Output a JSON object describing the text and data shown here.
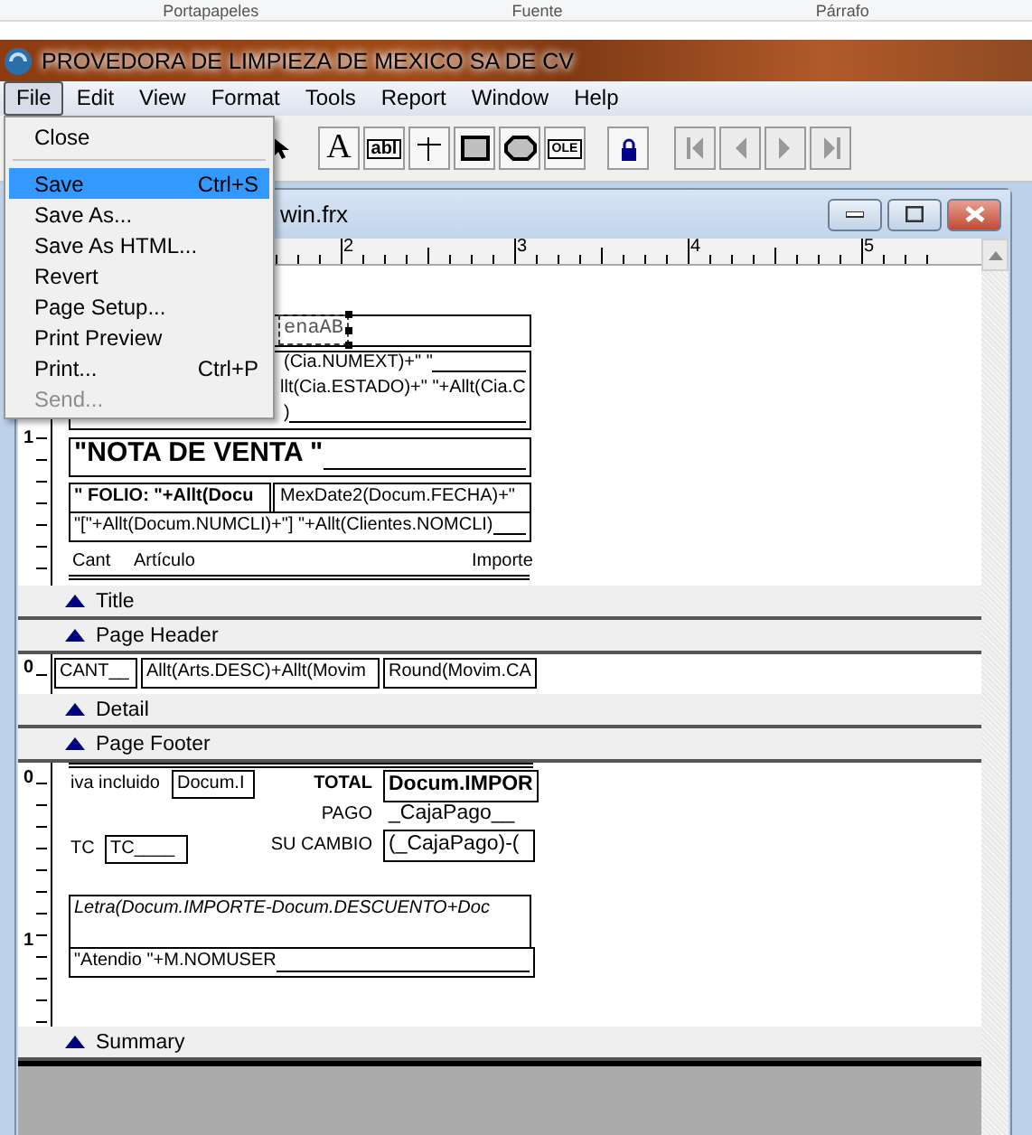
{
  "ribbon_fragment": [
    "Portapapeles",
    "Fuente",
    "Párrafo"
  ],
  "window": {
    "title": "PROVEDORA DE LIMPIEZA DE MEXICO SA DE CV"
  },
  "menu_bar": [
    {
      "label": "File",
      "selected": true
    },
    {
      "label": "Edit",
      "selected": false
    },
    {
      "label": "View",
      "selected": false
    },
    {
      "label": "Format",
      "selected": false
    },
    {
      "label": "Tools",
      "selected": false
    },
    {
      "label": "Report",
      "selected": false
    },
    {
      "label": "Window",
      "selected": false
    },
    {
      "label": "Help",
      "selected": false
    }
  ],
  "toolbar": [
    {
      "kind": "pointer",
      "disabled": false
    },
    {
      "kind": "label",
      "glyph": "A",
      "disabled": false
    },
    {
      "kind": "field",
      "glyph": "abl",
      "disabled": false
    },
    {
      "kind": "line",
      "disabled": false
    },
    {
      "kind": "rectangle",
      "disabled": false
    },
    {
      "kind": "rounded",
      "disabled": false
    },
    {
      "kind": "picture",
      "glyph": "OLE",
      "disabled": false
    },
    {
      "kind": "lock",
      "disabled": false
    },
    {
      "kind": "first",
      "disabled": true
    },
    {
      "kind": "previous",
      "disabled": true
    },
    {
      "kind": "next",
      "disabled": true
    },
    {
      "kind": "last",
      "disabled": true
    }
  ],
  "file_menu": [
    {
      "kind": "item",
      "label": "Close",
      "selected": false,
      "disabled": false
    },
    {
      "kind": "separator"
    },
    {
      "kind": "item",
      "label": "Save",
      "shortcut": "Ctrl+S",
      "selected": true,
      "disabled": false
    },
    {
      "kind": "item",
      "label": "Save As...",
      "selected": false,
      "disabled": false
    },
    {
      "kind": "item",
      "label": "Save As HTML...",
      "selected": false,
      "disabled": false
    },
    {
      "kind": "item",
      "label": "Revert",
      "selected": false,
      "disabled": false
    },
    {
      "kind": "item",
      "label": "Page Setup...",
      "selected": false,
      "disabled": false
    },
    {
      "kind": "item",
      "label": "Print Preview",
      "selected": false,
      "disabled": false
    },
    {
      "kind": "item",
      "label": "Print...",
      "shortcut": "Ctrl+P",
      "selected": false,
      "disabled": false
    },
    {
      "kind": "item",
      "label": "Send...",
      "selected": false,
      "disabled": true
    }
  ],
  "report_window": {
    "title": "win.frx",
    "ruler": [
      "2",
      "3",
      "4",
      "5"
    ],
    "bands": [
      {
        "kind": "content",
        "ruler_marks": [
          "1"
        ],
        "fields": [
          {
            "text": "enaAB",
            "selected": true
          },
          {
            "text": "(Cia.NUMEXT)+\" \"",
            "selected": false
          },
          {
            "text": "llt(Cia.ESTADO)+\" \"+Allt(Cia.C",
            "selected": false
          },
          {
            "text": ")",
            "selected": false
          },
          {
            "text": "\"NOTA DE VENTA \"",
            "selected": false
          },
          {
            "text": "\" FOLIO: \"+Allt(Docu",
            "selected": false
          },
          {
            "text": "MexDate2(Docum.FECHA)+\"",
            "selected": false
          },
          {
            "text": "\"[\"+Allt(Docum.NUMCLI)+\"]  \"+Allt(Clientes.NOMCLI)",
            "selected": false
          },
          {
            "text": "Cant",
            "selected": false
          },
          {
            "text": "Artículo",
            "selected": false
          },
          {
            "text": "Importe",
            "selected": false
          }
        ]
      },
      {
        "kind": "bar",
        "label": "Title"
      },
      {
        "kind": "bar",
        "label": "Page Header"
      },
      {
        "kind": "content",
        "ruler_marks": [
          "0"
        ],
        "fields": [
          {
            "text": "CANT__",
            "selected": false
          },
          {
            "text": "Allt(Arts.DESC)+Allt(Movim",
            "selected": false
          },
          {
            "text": "Round(Movim.CA",
            "selected": false
          }
        ]
      },
      {
        "kind": "bar",
        "label": "Detail"
      },
      {
        "kind": "bar",
        "label": "Page Footer"
      },
      {
        "kind": "content",
        "ruler_marks": [
          "0",
          "1"
        ],
        "fields": [
          {
            "text": "iva incluido",
            "selected": false
          },
          {
            "text": "Docum.I",
            "selected": false
          },
          {
            "text": "TOTAL",
            "selected": false
          },
          {
            "text": "Docum.IMPOR",
            "selected": false
          },
          {
            "text": "PAGO",
            "selected": false
          },
          {
            "text": "_CajaPago__",
            "selected": false
          },
          {
            "text": "TC",
            "selected": false
          },
          {
            "text": "TC____",
            "selected": false
          },
          {
            "text": "SU CAMBIO",
            "selected": false
          },
          {
            "text": "(_CajaPago)-(",
            "selected": false
          },
          {
            "text": "Letra(Docum.IMPORTE-Docum.DESCUENTO+Doc",
            "selected": false
          },
          {
            "text": "\"Atendio \"+M.NOMUSER",
            "selected": false
          }
        ]
      },
      {
        "kind": "bar",
        "label": "Summary"
      }
    ]
  }
}
